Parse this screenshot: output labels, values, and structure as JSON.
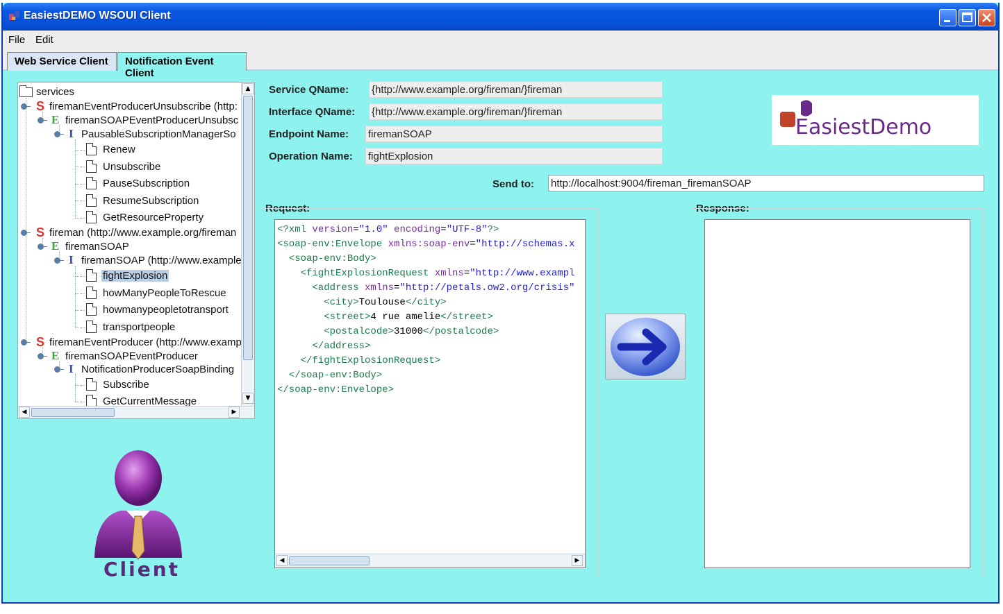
{
  "window": {
    "title": "EasiestDEMO WSOUI Client"
  },
  "menu": [
    "File",
    "Edit"
  ],
  "tabs": [
    {
      "label": "Web Service Client",
      "active": true
    },
    {
      "label": "Notification Event Client",
      "active": false
    }
  ],
  "tree": {
    "root": "services",
    "nodes": [
      {
        "type": "S",
        "label": "firemanEventProducerUnsubscribe (http:"
      },
      {
        "type": "E",
        "label": "firemanSOAPEventProducerUnsubsc"
      },
      {
        "type": "I",
        "label": "PausableSubscriptionManagerSo"
      },
      {
        "type": "op",
        "label": "Renew"
      },
      {
        "type": "op",
        "label": "Unsubscribe"
      },
      {
        "type": "op",
        "label": "PauseSubscription"
      },
      {
        "type": "op",
        "label": "ResumeSubscription"
      },
      {
        "type": "op",
        "label": "GetResourceProperty"
      },
      {
        "type": "S",
        "label": "fireman (http://www.example.org/fireman"
      },
      {
        "type": "E",
        "label": "firemanSOAP"
      },
      {
        "type": "I",
        "label": "firemanSOAP (http://www.example"
      },
      {
        "type": "op",
        "label": "fightExplosion",
        "selected": true
      },
      {
        "type": "op",
        "label": "howManyPeopleToRescue"
      },
      {
        "type": "op",
        "label": "howmanypeopletotransport"
      },
      {
        "type": "op",
        "label": "transportpeople"
      },
      {
        "type": "S",
        "label": "firemanEventProducer (http://www.examp"
      },
      {
        "type": "E",
        "label": "firemanSOAPEventProducer"
      },
      {
        "type": "I",
        "label": "NotificationProducerSoapBinding"
      },
      {
        "type": "op",
        "label": "Subscribe"
      },
      {
        "type": "op",
        "label": "GetCurrentMessage"
      }
    ]
  },
  "fields": {
    "service_qname_label": "Service QName:",
    "service_qname": "{http://www.example.org/fireman/}fireman",
    "interface_qname_label": "Interface QName:",
    "interface_qname": "{http://www.example.org/fireman/}fireman",
    "endpoint_label": "Endpoint Name:",
    "endpoint": "firemanSOAP",
    "operation_label": "Operation Name:",
    "operation": "fightExplosion",
    "sendto_label": "Send to:",
    "sendto": "http://localhost:9004/fireman_firemanSOAP"
  },
  "request": {
    "label": "Request:",
    "lines": [
      "<?xml version=\"1.0\" encoding=\"UTF-8\"?>",
      "<soap-env:Envelope xmlns:soap-env=\"http://schemas.x",
      "  <soap-env:Body>",
      "    <fightExplosionRequest xmlns=\"http://www.exampl",
      "      <address xmlns=\"http://petals.ow2.org/crisis\"",
      "        <city>Toulouse</city>",
      "        <street>4 rue amelie</street>",
      "        <postalcode>31000</postalcode>",
      "      </address>",
      "    </fightExplosionRequest>",
      "  </soap-env:Body>",
      "</soap-env:Envelope>"
    ]
  },
  "response": {
    "label": "Response:"
  },
  "logo": {
    "text": "EasiestDemo",
    "color": "#6a2a8a",
    "accent": "#c0432a"
  },
  "client": {
    "label": "Client",
    "color": "#5a2a7a"
  },
  "colors": {
    "background": "#8ef3ee",
    "titlebar": "#0a58e3"
  }
}
